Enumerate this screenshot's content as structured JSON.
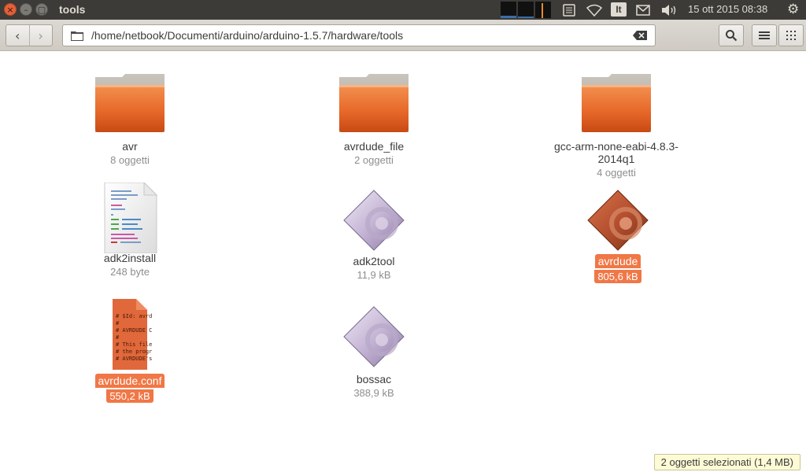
{
  "window": {
    "title": "tools",
    "buttons": {
      "close": "×",
      "minimize": "–",
      "maximize": "▢"
    }
  },
  "panel": {
    "keyboard_layout": "It",
    "clock": "15 ott 2015 08:38"
  },
  "toolbar": {
    "back": "‹",
    "forward": "›",
    "path": "/home/netbook/Documenti/arduino/arduino-1.5.7/hardware/tools"
  },
  "files": [
    {
      "name": "avr",
      "meta": "8 oggetti",
      "type": "folder",
      "selected": false
    },
    {
      "name": "avrdude_file",
      "meta": "2 oggetti",
      "type": "folder",
      "selected": false
    },
    {
      "name": "gcc-arm-none-eabi-4.8.3-2014q1",
      "meta": "4 oggetti",
      "type": "folder",
      "selected": false
    },
    {
      "name": "adk2install",
      "meta": "248 byte",
      "type": "script",
      "selected": false
    },
    {
      "name": "adk2tool",
      "meta": "11,9 kB",
      "type": "executable",
      "selected": false
    },
    {
      "name": "avrdude",
      "meta": "805,6 kB",
      "type": "executable",
      "selected": true
    },
    {
      "name": "avrdude.conf",
      "meta": "550,2 kB",
      "type": "text",
      "selected": true
    },
    {
      "name": "bossac",
      "meta": "388,9 kB",
      "type": "executable",
      "selected": false
    }
  ],
  "conf_preview": [
    "# $Id: avrd",
    "#",
    "# AVRDUDE C",
    "#",
    "# This file",
    "# the progr",
    "# AVRDUDE's"
  ],
  "status": "2 oggetti selezionati  (1,4 MB)",
  "colors": {
    "accent": "#f07746",
    "panel_bg": "#3c3b37",
    "folder_orange": "#e8742c"
  }
}
